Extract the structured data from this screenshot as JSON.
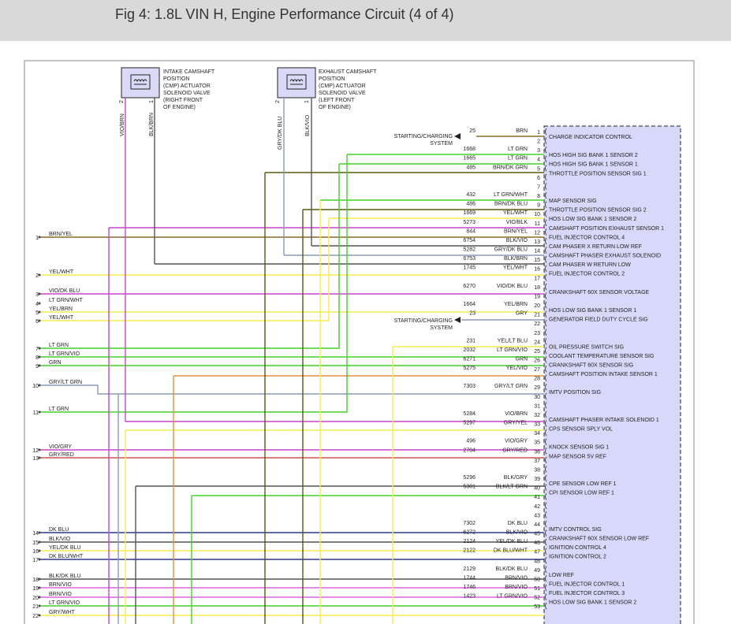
{
  "title": "Fig 4: 1.8L VIN H, Engine Performance Circuit (4 of 4)",
  "actuators": [
    {
      "label": [
        "INTAKE CAMSHAFT",
        "POSITION",
        "(CMP) ACTUATOR",
        "SOLENOID VALVE",
        "(RIGHT FRONT",
        "OF ENGINE)"
      ],
      "pins": [
        "2",
        "1"
      ],
      "wires": [
        "VIO/BRN",
        "BLK/BRN"
      ]
    },
    {
      "label": [
        "EXHAUST CAMSHAFT",
        "POSITION",
        "(CMP) ACTUATOR",
        "SOLENOID VALVE",
        "(LEFT FRONT",
        "OF ENGINE)"
      ],
      "pins": [
        "2",
        "1"
      ],
      "wires": [
        "GRY/DK BLU",
        "BLK/VIO"
      ]
    }
  ],
  "starting_label": [
    "STARTING/CHARGING",
    "SYSTEM"
  ],
  "pins": [
    {
      "p": "1",
      "c": "25",
      "w": "BRN",
      "s": "CHARGE INDICATOR CONTROL"
    },
    {
      "p": "2",
      "c": "",
      "w": "",
      "s": ""
    },
    {
      "p": "3",
      "c": "1668",
      "w": "LT GRN",
      "s": "HOS HIGH SIG BANK 1 SENSOR 2"
    },
    {
      "p": "4",
      "c": "1665",
      "w": "LT GRN",
      "s": "HOS HIGH SIG BANK 1 SENSOR 1"
    },
    {
      "p": "5",
      "c": "485",
      "w": "BRN/DK GRN",
      "s": "THROTTLE POSITION SENSOR SIG 1"
    },
    {
      "p": "6",
      "c": "",
      "w": "",
      "s": ""
    },
    {
      "p": "7",
      "c": "",
      "w": "",
      "s": ""
    },
    {
      "p": "8",
      "c": "432",
      "w": "LT GRN/WHT",
      "s": "MAP SENSOR SIG"
    },
    {
      "p": "9",
      "c": "486",
      "w": "BRN/DK BLU",
      "s": "THROTTLE POSITION SENSOR SIG 2"
    },
    {
      "p": "10",
      "c": "1669",
      "w": "YEL/WHT",
      "s": "HOS LOW SIG BANK 1 SENSOR 2"
    },
    {
      "p": "11",
      "c": "5273",
      "w": "VIO/BLK",
      "s": "CAMSHAFT POSITION EXHAUST SENSOR 1"
    },
    {
      "p": "12",
      "c": "844",
      "w": "BRN/YEL",
      "s": "FUEL INJECTOR CONTROL 4"
    },
    {
      "p": "13",
      "c": "6754",
      "w": "BLK/VIO",
      "s": "CAM PHASER X RETURN LOW REF"
    },
    {
      "p": "14",
      "c": "5282",
      "w": "GRY/DK BLU",
      "s": "CAMSHAFT PHASER EXHAUST SOLENOID"
    },
    {
      "p": "15",
      "c": "6753",
      "w": "BLK/BRN",
      "s": "CAM PHASER W RETURN LOW"
    },
    {
      "p": "16",
      "c": "1745",
      "w": "YEL/WHT",
      "s": "FUEL INJECTOR CONTROL 2"
    },
    {
      "p": "17",
      "c": "",
      "w": "",
      "s": ""
    },
    {
      "p": "18",
      "c": "6270",
      "w": "VIO/DK BLU",
      "s": "CRANKSHAFT 60X SENSOR VOLTAGE"
    },
    {
      "p": "19",
      "c": "",
      "w": "",
      "s": ""
    },
    {
      "p": "20",
      "c": "1664",
      "w": "YEL/BRN",
      "s": "HOS LOW SIG BANK 1 SENSOR 1"
    },
    {
      "p": "21",
      "c": "23",
      "w": "GRY",
      "s": "GENERATOR FIELD DUTY CYCLE SIG"
    },
    {
      "p": "22",
      "c": "",
      "w": "",
      "s": ""
    },
    {
      "p": "23",
      "c": "",
      "w": "",
      "s": ""
    },
    {
      "p": "24",
      "c": "231",
      "w": "YEL/LT BLU",
      "s": "OIL PRESSURE SWITCH SIG"
    },
    {
      "p": "25",
      "c": "2032",
      "w": "LT GRN/VIO",
      "s": "COOLANT TEMPERATURE SENSOR SIG"
    },
    {
      "p": "26",
      "c": "6271",
      "w": "GRN",
      "s": "CRANKSHAFT 60X SENSOR SIG"
    },
    {
      "p": "27",
      "c": "5275",
      "w": "YEL/VIO",
      "s": "CAMSHAFT POSITION INTAKE SENSOR 1"
    },
    {
      "p": "28",
      "c": "",
      "w": "",
      "s": ""
    },
    {
      "p": "29",
      "c": "7303",
      "w": "GRY/LT GRN",
      "s": "IMTV POSITION SIG"
    },
    {
      "p": "30",
      "c": "",
      "w": "",
      "s": ""
    },
    {
      "p": "31",
      "c": "",
      "w": "",
      "s": ""
    },
    {
      "p": "32",
      "c": "5284",
      "w": "VIO/BRN",
      "s": "CAMSHAFT PHASER INTAKE SOLENOID 1"
    },
    {
      "p": "33",
      "c": "5297",
      "w": "GRY/YEL",
      "s": "CPS SENSOR SPLY VOL"
    },
    {
      "p": "34",
      "c": "",
      "w": "",
      "s": ""
    },
    {
      "p": "35",
      "c": "496",
      "w": "VIO/GRY",
      "s": "KNOCK SENSOR SIG 1"
    },
    {
      "p": "36",
      "c": "2704",
      "w": "GRY/RED",
      "s": "MAP SENSOR 5V REF"
    },
    {
      "p": "37",
      "c": "",
      "w": "",
      "s": ""
    },
    {
      "p": "38",
      "c": "",
      "w": "",
      "s": ""
    },
    {
      "p": "39",
      "c": "5296",
      "w": "BLK/GRY",
      "s": "CPE SENSOR LOW REF 1"
    },
    {
      "p": "40",
      "c": "5301",
      "w": "BLK/LT GRN",
      "s": "CPI SENSOR LOW REF 1"
    },
    {
      "p": "41",
      "c": "",
      "w": "",
      "s": ""
    },
    {
      "p": "42",
      "c": "",
      "w": "",
      "s": ""
    },
    {
      "p": "43",
      "c": "",
      "w": "",
      "s": ""
    },
    {
      "p": "44",
      "c": "7302",
      "w": "DK BLU",
      "s": "IMTV CONTROL SIG"
    },
    {
      "p": "45",
      "c": "6272",
      "w": "BLK/VIO",
      "s": "CRANKSHAFT 60X SENSOR LOW REF"
    },
    {
      "p": "46",
      "c": "2124",
      "w": "YEL/DK BLU",
      "s": "IGNITION CONTROL 4"
    },
    {
      "p": "47",
      "c": "2122",
      "w": "DK BLU/WHT",
      "s": "IGNITION CONTROL 2"
    },
    {
      "p": "48",
      "c": "",
      "w": "",
      "s": ""
    },
    {
      "p": "49",
      "c": "2129",
      "w": "BLK/DK BLU",
      "s": "LOW REF"
    },
    {
      "p": "50",
      "c": "1744",
      "w": "BRN/VIO",
      "s": "FUEL INJECTOR CONTROL 1"
    },
    {
      "p": "51",
      "c": "1746",
      "w": "BRN/VIO",
      "s": "FUEL INJECTOR CONTROL 3"
    },
    {
      "p": "52",
      "c": "1423",
      "w": "LT GRN/VIO",
      "s": "HOS LOW SIG BANK 1 SENSOR 2"
    },
    {
      "p": "53",
      "c": "",
      "w": "",
      "s": ""
    }
  ],
  "left_terminals": [
    {
      "n": "1",
      "w": "BRN/YEL"
    },
    {
      "n": "2",
      "w": "YEL/WHT"
    },
    {
      "n": "3",
      "w": "VIO/DK BLU"
    },
    {
      "n": "4",
      "w": "LT GRN/WHT"
    },
    {
      "n": "5",
      "w": "YEL/BRN"
    },
    {
      "n": "6",
      "w": "YEL/WHT"
    },
    {
      "n": "7",
      "w": "LT GRN"
    },
    {
      "n": "8",
      "w": "LT GRN/VIO"
    },
    {
      "n": "9",
      "w": "GRN"
    },
    {
      "n": "10",
      "w": "GRY/LT GRN"
    },
    {
      "n": "11",
      "w": "LT GRN"
    },
    {
      "n": "12",
      "w": "VIO/GRY"
    },
    {
      "n": "13",
      "w": "GRY/RED"
    },
    {
      "n": "14",
      "w": "DK BLU"
    },
    {
      "n": "15",
      "w": "BLK/VIO"
    },
    {
      "n": "16",
      "w": "YEL/DK BLU"
    },
    {
      "n": "17",
      "w": "DK BLU/WHT"
    },
    {
      "n": "18",
      "w": "BLK/DK BLU"
    },
    {
      "n": "19",
      "w": "BRN/VIO"
    },
    {
      "n": "20",
      "w": "BRN/VIO"
    },
    {
      "n": "21",
      "w": "LT GRN/VIO"
    },
    {
      "n": "22",
      "w": "GRY/WHT"
    }
  ],
  "colors": {
    "ecm_fill": "#d8d8fa",
    "header_bg": "#d9d9d9",
    "brown": "#8a6a2a",
    "green": "#44d02a",
    "dark_olive": "#5a5a10",
    "yellow": "#f2ee50",
    "violet": "#cc44cc",
    "gray_blue": "#8a9ab4",
    "dark_gray": "#555555",
    "blue": "#2a3a8c",
    "red": "#d05050",
    "orange": "#e09040",
    "pink": "#dd66dd"
  }
}
